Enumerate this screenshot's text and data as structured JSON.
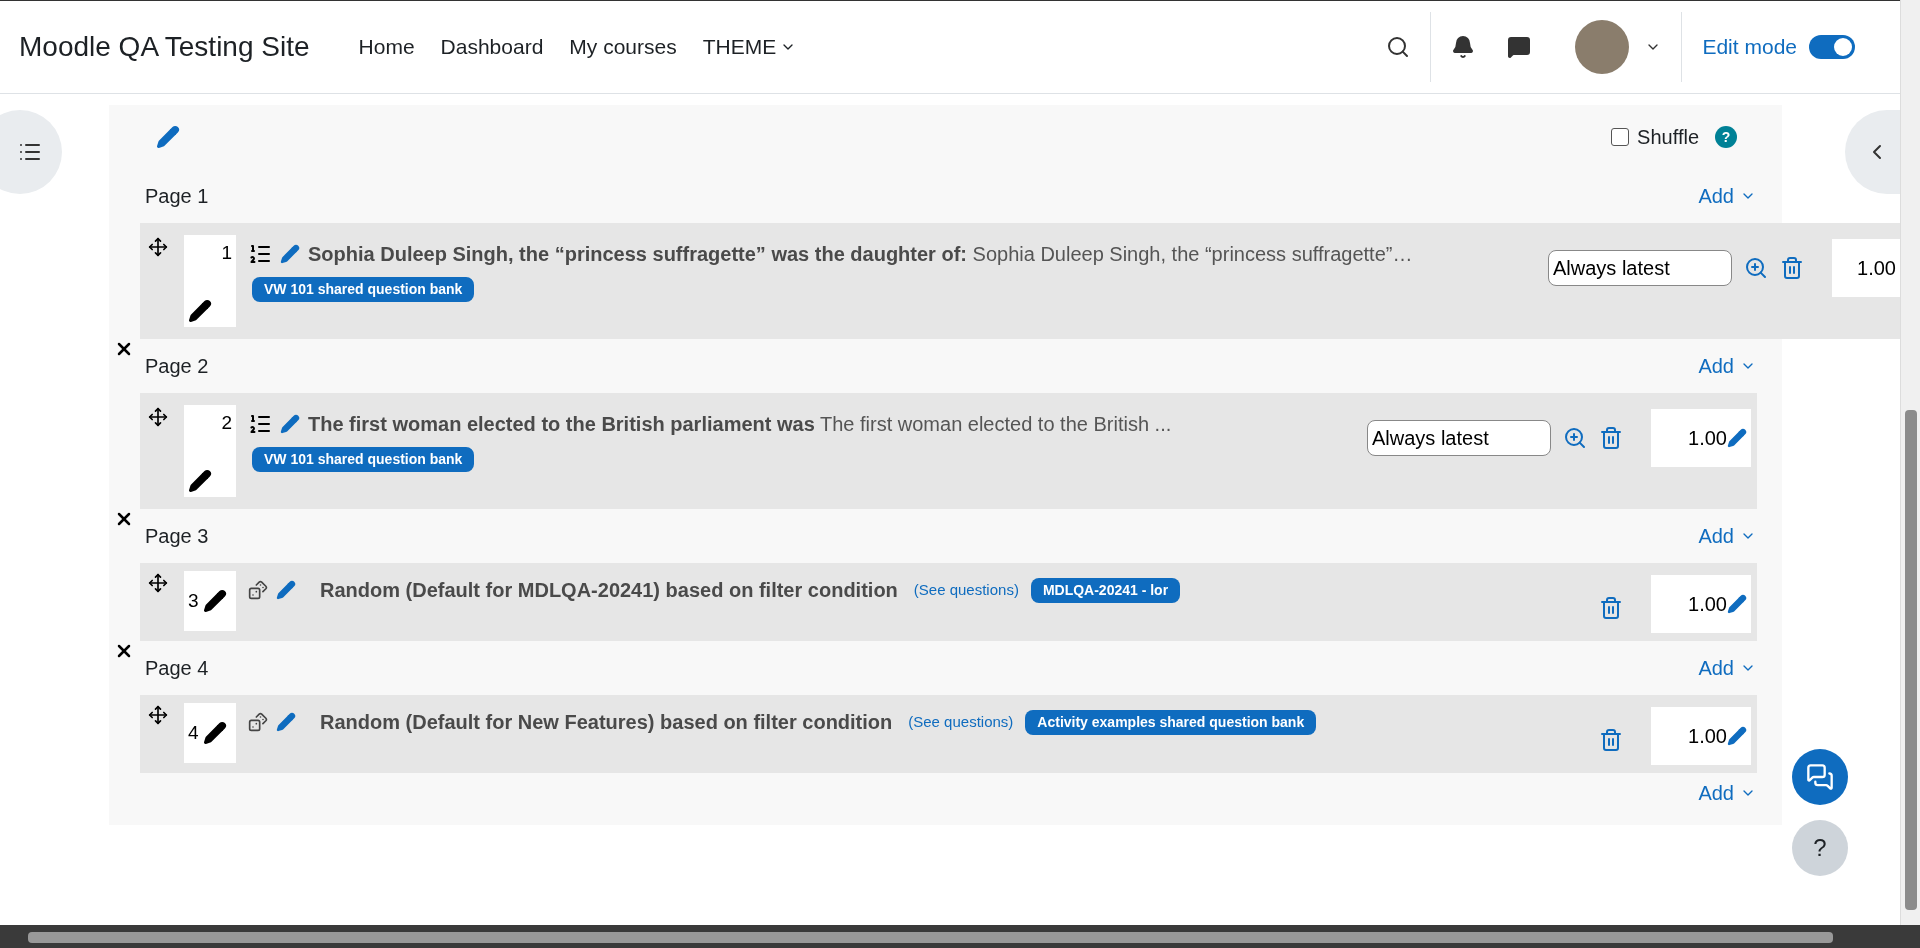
{
  "site_name": "Moodle QA Testing Site",
  "nav": [
    {
      "label": "Home",
      "has_menu": false
    },
    {
      "label": "Dashboard",
      "has_menu": false
    },
    {
      "label": "My courses",
      "has_menu": false
    },
    {
      "label": "THEME",
      "has_menu": true
    }
  ],
  "edit_mode": {
    "label": "Edit mode",
    "on": true
  },
  "shuffle": {
    "label": "Shuffle",
    "checked": false,
    "help": "?"
  },
  "pages": [
    {
      "label": "Page 1",
      "add_label": "Add",
      "questions": [
        {
          "kind": "question",
          "number": "1",
          "title": "Sophia Duleep Singh, the “princess suffragette” was the daughter of:",
          "text": "Sophia Duleep Singh, the “princess suffragette”…",
          "bank": "VW 101 shared question bank",
          "version": "Always latest",
          "mark": "1.00"
        }
      ]
    },
    {
      "label": "Page 2",
      "add_label": "Add",
      "questions": [
        {
          "kind": "question",
          "number": "2",
          "title": "The first woman elected to the British parliament was",
          "text": "The first woman elected to the British ...",
          "bank": "VW 101 shared question bank",
          "version": "Always latest",
          "mark": "1.00"
        }
      ]
    },
    {
      "label": "Page 3",
      "add_label": "Add",
      "questions": [
        {
          "kind": "random",
          "number": "3",
          "title": "Random (Default for MDLQA-20241) based on filter condition",
          "link": "(See questions)",
          "bank": "MDLQA-20241 - lor",
          "mark": "1.00"
        }
      ]
    },
    {
      "label": "Page 4",
      "add_label": "Add",
      "questions": [
        {
          "kind": "random",
          "number": "4",
          "title": "Random (Default for New Features) based on filter condition",
          "link": "(See questions)",
          "bank": "Activity examples shared question bank",
          "mark": "1.00"
        }
      ]
    }
  ],
  "final_add": "Add",
  "help_button": "?"
}
